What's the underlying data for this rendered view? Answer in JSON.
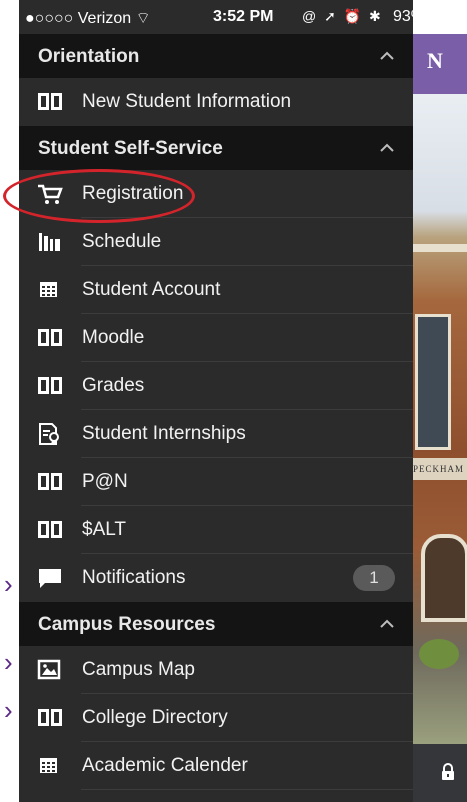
{
  "status_bar": {
    "carrier": "●○○○○ Verizon ⌔",
    "time": "3:52 PM",
    "icons": "@ ➚ ⏰ ✱",
    "battery": "93%"
  },
  "sections": [
    {
      "title": "Orientation",
      "items": [
        {
          "label": "New Student Information",
          "icon": "book-icon"
        }
      ]
    },
    {
      "title": "Student Self-Service",
      "items": [
        {
          "label": "Registration",
          "icon": "cart-icon"
        },
        {
          "label": "Schedule",
          "icon": "books-icon"
        },
        {
          "label": "Student Account",
          "icon": "grid-icon"
        },
        {
          "label": "Moodle",
          "icon": "book-icon"
        },
        {
          "label": "Grades",
          "icon": "book-icon"
        },
        {
          "label": "Student Internships",
          "icon": "certificate-icon"
        },
        {
          "label": "P@N",
          "icon": "book-icon"
        },
        {
          "label": "$ALT",
          "icon": "book-icon"
        },
        {
          "label": "Notifications",
          "icon": "chat-icon",
          "badge": "1"
        }
      ]
    },
    {
      "title": "Campus Resources",
      "items": [
        {
          "label": "Campus Map",
          "icon": "map-icon"
        },
        {
          "label": "College Directory",
          "icon": "book-icon"
        },
        {
          "label": "Academic Calender",
          "icon": "grid-icon"
        }
      ]
    }
  ],
  "right_panel": {
    "logo_letter": "N",
    "sign_text": "PECKHAM"
  },
  "colors": {
    "menu_bg": "#2b2b2b",
    "header_bg": "#141414",
    "highlight": "#d3242b",
    "brand_purple": "#7b5ea8"
  }
}
